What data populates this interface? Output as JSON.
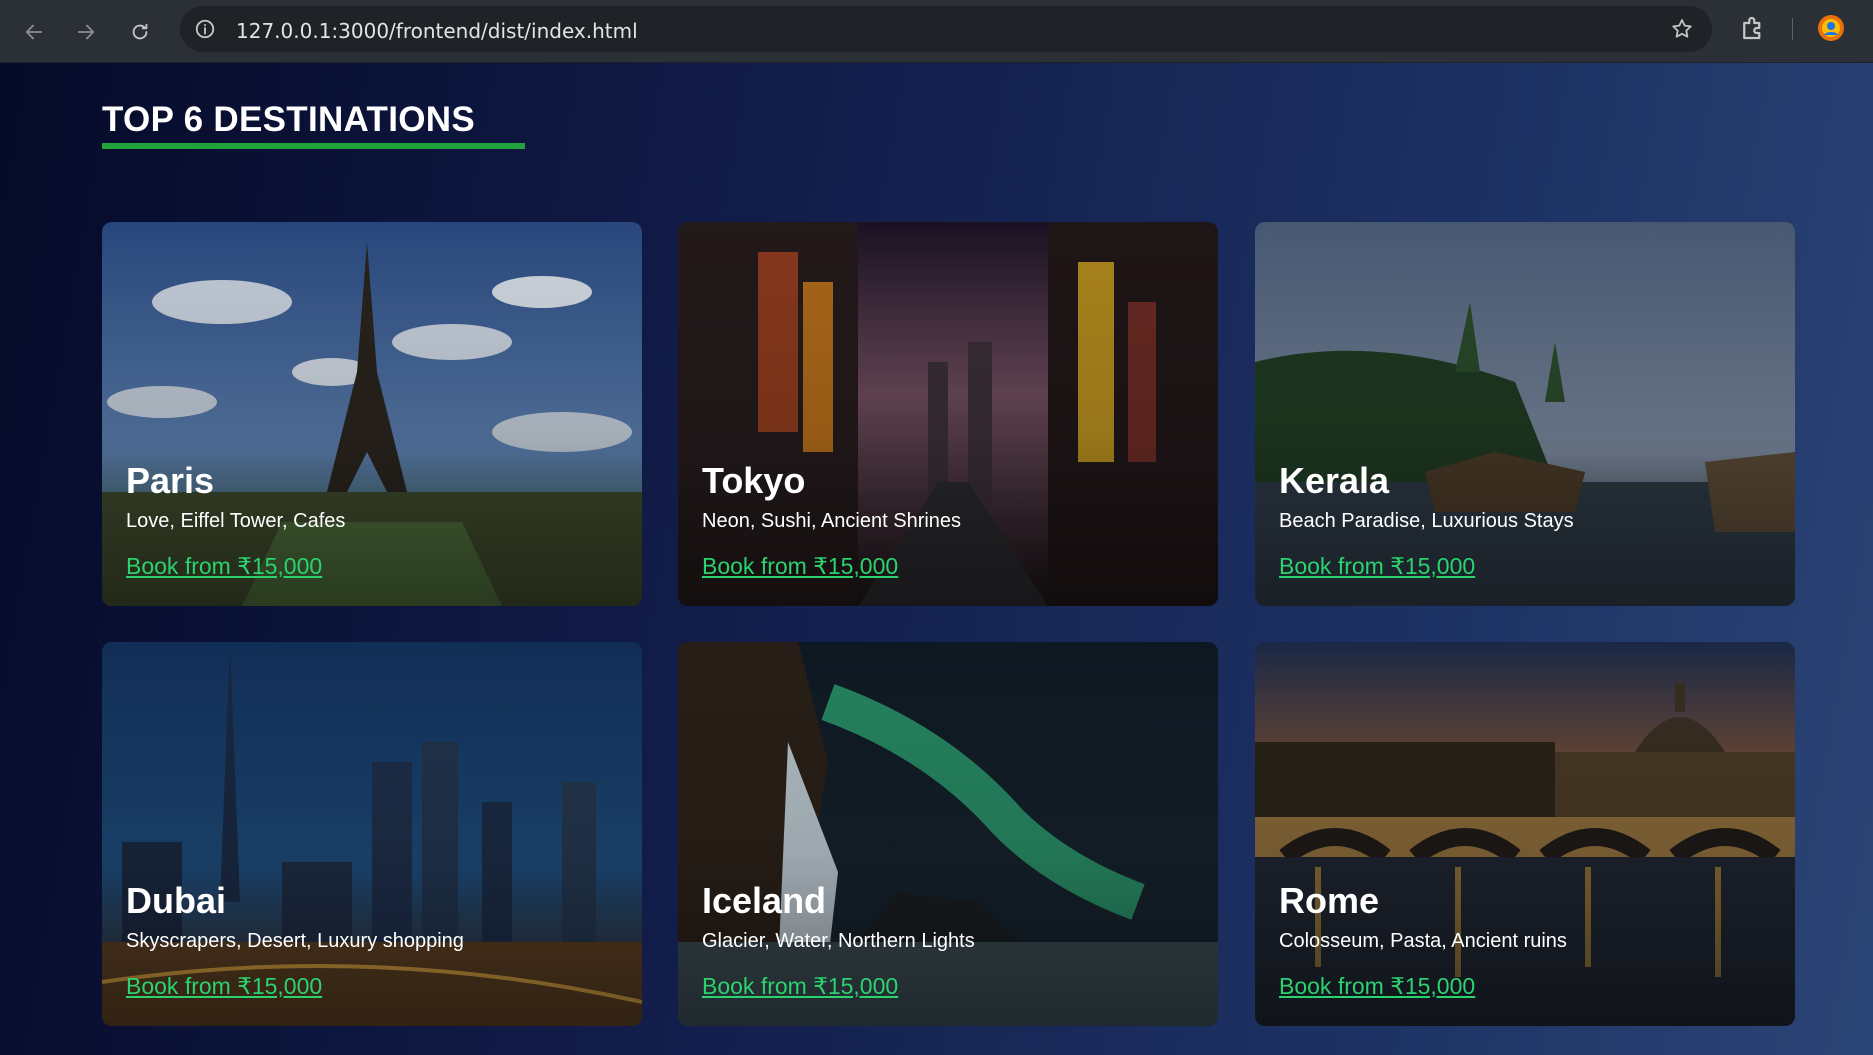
{
  "browser": {
    "url": "127.0.0.1:3000/frontend/dist/index.html"
  },
  "section": {
    "heading": "TOP 6 DESTINATIONS",
    "underline_color": "#1fa33a"
  },
  "destinations": [
    {
      "name": "Paris",
      "description": "Love, Eiffel Tower, Cafes",
      "cta": "Book from ₹15,000"
    },
    {
      "name": "Tokyo",
      "description": "Neon, Sushi, Ancient Shrines",
      "cta": "Book from ₹15,000"
    },
    {
      "name": "Kerala",
      "description": "Beach Paradise, Luxurious Stays",
      "cta": "Book from ₹15,000"
    },
    {
      "name": "Dubai",
      "description": "Skyscrapers, Desert, Luxury shopping",
      "cta": "Book from ₹15,000"
    },
    {
      "name": "Iceland",
      "description": "Glacier, Water, Northern Lights",
      "cta": "Book from ₹15,000"
    },
    {
      "name": "Rome",
      "description": "Colosseum, Pasta, Ancient ruins",
      "cta": "Book from ₹15,000"
    }
  ],
  "colors": {
    "link": "#2bd36f",
    "page_bg_start": "#050a28",
    "page_bg_end": "#2b4576"
  }
}
